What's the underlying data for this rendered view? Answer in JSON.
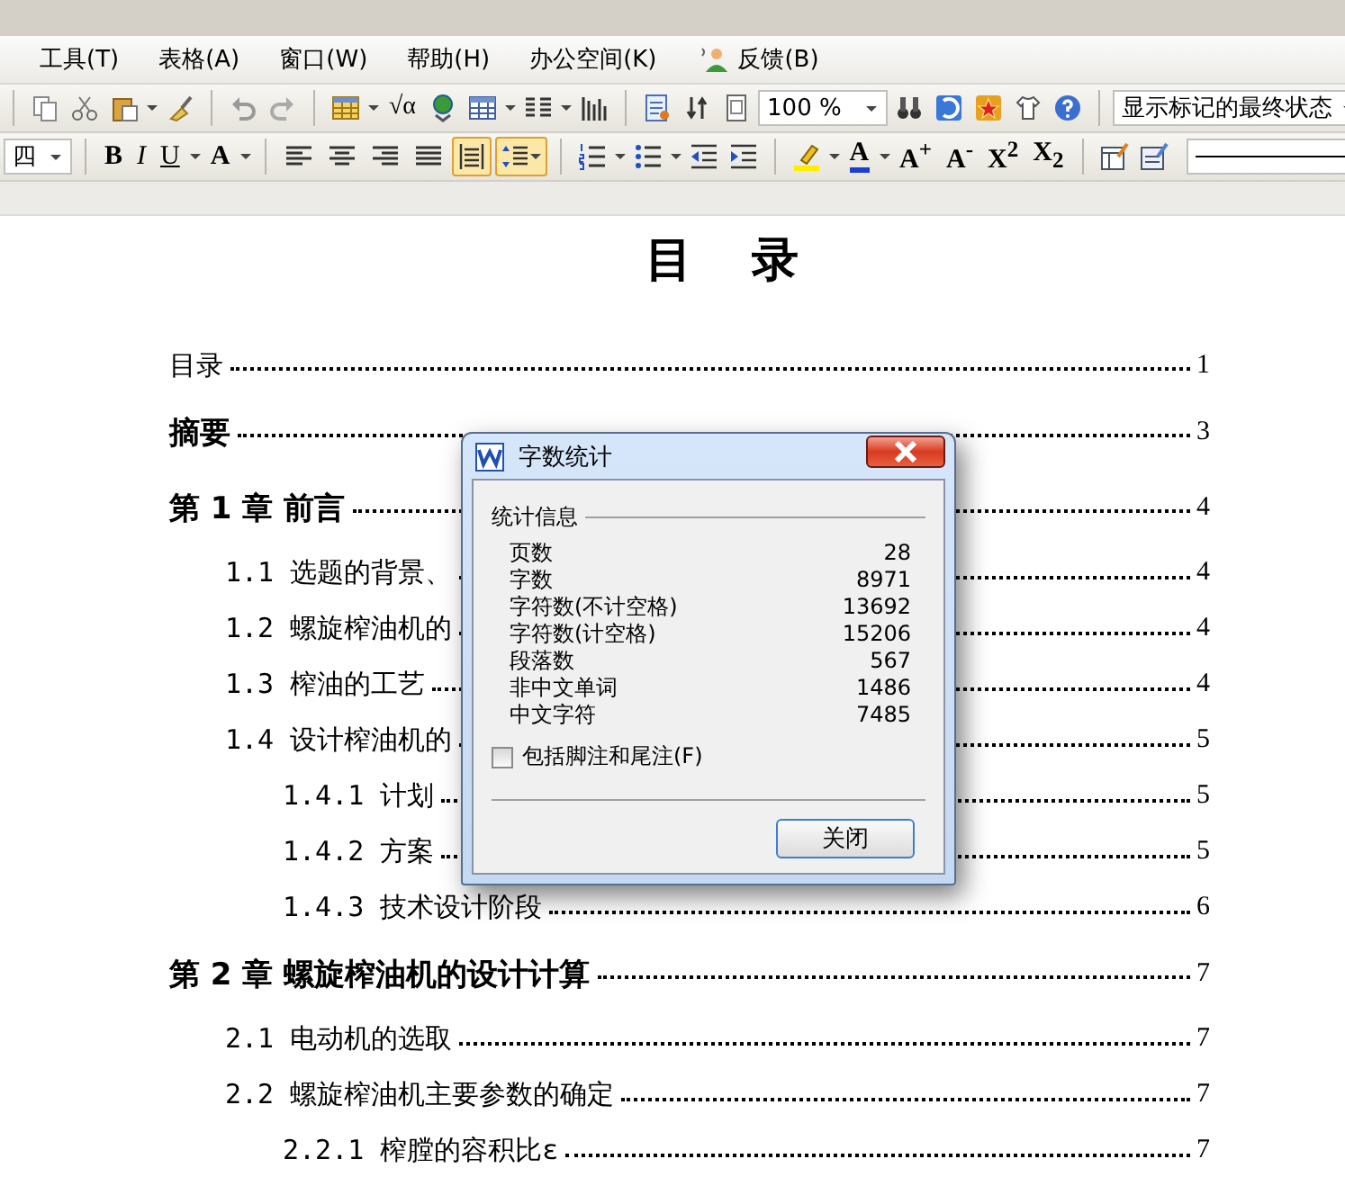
{
  "menu_bar": {
    "items": [
      {
        "label": "工具(T)",
        "kind": "plain"
      },
      {
        "label": "表格(A)",
        "kind": "plain"
      },
      {
        "label": "窗口(W)",
        "kind": "plain"
      },
      {
        "label": "帮助(H)",
        "kind": "plain"
      },
      {
        "label": "办公空间(K)",
        "kind": "plain"
      },
      {
        "label": "反馈(B)",
        "kind": "feedback"
      }
    ]
  },
  "standard_toolbar": {
    "formula_label": "√α",
    "zoom": "100 %",
    "markup_view": "显示标记的最终状态"
  },
  "formatting_toolbar": {
    "font_size": "四",
    "style_buttons": [
      {
        "kind": "bold",
        "label": "B"
      },
      {
        "kind": "italic",
        "label": "I"
      },
      {
        "kind": "underline",
        "label": "U"
      },
      {
        "kind": "effect",
        "label": "A"
      }
    ],
    "alignment_buttons": [
      {
        "selected": false
      },
      {
        "selected": false
      },
      {
        "selected": false
      },
      {
        "selected": false
      },
      {
        "selected": true
      }
    ],
    "line_spacing": {
      "selected": true
    },
    "text_buttons": [
      {
        "kind": "font_color",
        "label": "A"
      },
      {
        "kind": "grow",
        "label": "A$^{+}$"
      },
      {
        "kind": "shrink",
        "label": "A$^{-}$"
      },
      {
        "kind": "superscript",
        "label": "X$^{2}$"
      },
      {
        "kind": "subscript",
        "label": "X$_{2}$"
      }
    ]
  },
  "document": {
    "title": "目 录",
    "toc": [
      {
        "kind": "contents",
        "text": "目录",
        "page": "1"
      },
      {
        "kind": "heading",
        "text": "摘要",
        "page": "3"
      },
      {
        "kind": "heading",
        "text": "第 1 章  前言",
        "page": "4",
        "children": [
          {
            "kind": "section",
            "text": "1.1 选题的背景、",
            "page": "4"
          },
          {
            "kind": "section",
            "text": "1.2 螺旋榨油机的",
            "page": "4"
          },
          {
            "kind": "section",
            "text": "1.3  榨油的工艺",
            "page": "4"
          },
          {
            "kind": "section",
            "text": "1.4 设计榨油机的",
            "page": "5",
            "children": [
              {
                "kind": "section",
                "text": "1.4.1  计划",
                "page": "5"
              },
              {
                "kind": "section",
                "text": "1.4.2  方案",
                "page": "5"
              },
              {
                "kind": "section",
                "text": "1.4.3  技术设计阶段",
                "page": "6"
              }
            ]
          }
        ]
      },
      {
        "kind": "heading",
        "text": "第 2 章  螺旋榨油机的设计计算",
        "page": "7",
        "children": [
          {
            "kind": "section",
            "text": "2.1  电动机的选取",
            "page": "7"
          },
          {
            "kind": "section",
            "text": "2.2  螺旋榨油机主要参数的确定",
            "page": "7",
            "children": [
              {
                "kind": "section",
                "text": "2.2.1  榨膛的容积比ε",
                "page": "7"
              }
            ]
          }
        ]
      }
    ]
  },
  "word_count_dialog": {
    "title": "字数统计",
    "group_label": "统计信息",
    "stats": [
      {
        "label": "页数",
        "value": "28"
      },
      {
        "label": "字数",
        "value": "8971"
      },
      {
        "label": "字符数(不计空格)",
        "value": "13692"
      },
      {
        "label": "字符数(计空格)",
        "value": "15206"
      },
      {
        "label": "段落数",
        "value": "567"
      },
      {
        "label": "非中文单词",
        "value": "1486"
      },
      {
        "label": "中文字符",
        "value": "7485"
      }
    ],
    "include_footnotes": {
      "label": "包括脚注和尾注(F)",
      "checked": false
    },
    "close_button": "关闭"
  }
}
